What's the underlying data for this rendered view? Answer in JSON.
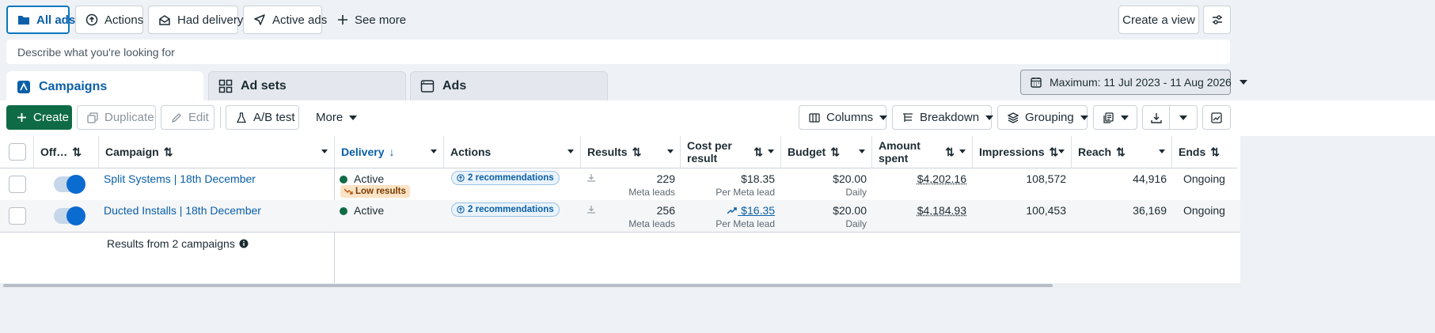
{
  "filters": {
    "all_ads": "All ads",
    "actions": "Actions",
    "had_delivery": "Had delivery",
    "active_ads": "Active ads",
    "see_more": "See more",
    "create_view": "Create a view"
  },
  "search": {
    "placeholder": "Describe what you're looking for"
  },
  "tabs": {
    "campaigns": "Campaigns",
    "ad_sets": "Ad sets",
    "ads": "Ads"
  },
  "date_range": "Maximum: 11 Jul 2023 - 11 Aug 2026",
  "toolbar": {
    "create": "Create",
    "duplicate": "Duplicate",
    "edit": "Edit",
    "ab_test": "A/B test",
    "more": "More",
    "columns": "Columns",
    "breakdown": "Breakdown",
    "grouping": "Grouping"
  },
  "table": {
    "headers": {
      "off_on": "Off…",
      "campaign": "Campaign",
      "delivery": "Delivery",
      "actions": "Actions",
      "results": "Results",
      "cost_per_result_1": "Cost per",
      "cost_per_result_2": "result",
      "budget": "Budget",
      "amount_spent_1": "Amount",
      "amount_spent_2": "spent",
      "impressions": "Impressions",
      "reach": "Reach",
      "ends": "Ends"
    },
    "rows": [
      {
        "campaign": "Split Systems | 18th December",
        "delivery": "Active",
        "delivery_note": "Low results",
        "actions": "2 recommendations",
        "results": "229",
        "results_sub": "Meta leads",
        "cost": "$18.35",
        "cost_sub": "Per Meta lead",
        "budget": "$20.00",
        "budget_sub": "Daily",
        "spent": "$4,202.16",
        "impressions": "108,572",
        "reach": "44,916",
        "ends": "Ongoing"
      },
      {
        "campaign": "Ducted Installs | 18th December",
        "delivery": "Active",
        "actions": "2 recommendations",
        "results": "256",
        "results_sub": "Meta leads",
        "cost": "$16.35",
        "cost_sub": "Per Meta lead",
        "budget": "$20.00",
        "budget_sub": "Daily",
        "spent": "$4,184.93",
        "impressions": "100,453",
        "reach": "36,169",
        "ends": "Ongoing"
      }
    ],
    "summary": "Results from 2 campaigns"
  },
  "colors": {
    "accent": "#0a5fa8",
    "create_button": "#0f6b45",
    "active_dot": "#0f6b45"
  }
}
